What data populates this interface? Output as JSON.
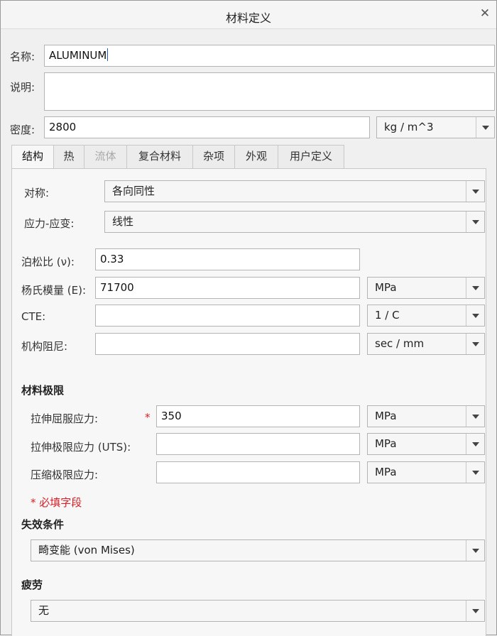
{
  "window": {
    "title": "材料定义",
    "close_glyph": "✕"
  },
  "header": {
    "name_label": "名称:",
    "name_value": "ALUMINUM",
    "desc_label": "说明:",
    "desc_value": "",
    "density_label": "密度:",
    "density_value": "2800",
    "density_unit": "kg / m^3"
  },
  "tabs": [
    {
      "label": "结构"
    },
    {
      "label": "热"
    },
    {
      "label": "流体"
    },
    {
      "label": "复合材料"
    },
    {
      "label": "杂项"
    },
    {
      "label": "外观"
    },
    {
      "label": "用户定义"
    }
  ],
  "structure": {
    "symmetry_label": "对称:",
    "symmetry_value": "各向同性",
    "stress_strain_label": "应力-应变:",
    "stress_strain_value": "线性",
    "poisson_label": "泊松比 (ν):",
    "poisson_value": "0.33",
    "youngs_label": "杨氏模量 (E):",
    "youngs_value": "71700",
    "youngs_unit": "MPa",
    "cte_label": "CTE:",
    "cte_value": "",
    "cte_unit": "1 / C",
    "damping_label": "机构阻尼:",
    "damping_value": "",
    "damping_unit": "sec / mm"
  },
  "limits": {
    "section_title": "材料极限",
    "tensile_yield_label": "拉伸屈服应力:",
    "tensile_yield_required_mark": "*",
    "tensile_yield_value": "350",
    "tensile_yield_unit": "MPa",
    "uts_label": "拉伸极限应力 (UTS):",
    "uts_value": "",
    "uts_unit": "MPa",
    "compressive_label": "压缩极限应力:",
    "compressive_value": "",
    "compressive_unit": "MPa",
    "required_note": "* 必填字段"
  },
  "failure": {
    "section_title": "失效条件",
    "value": "畸变能 (von Mises)"
  },
  "fatigue": {
    "section_title": "疲劳",
    "value": "无"
  }
}
